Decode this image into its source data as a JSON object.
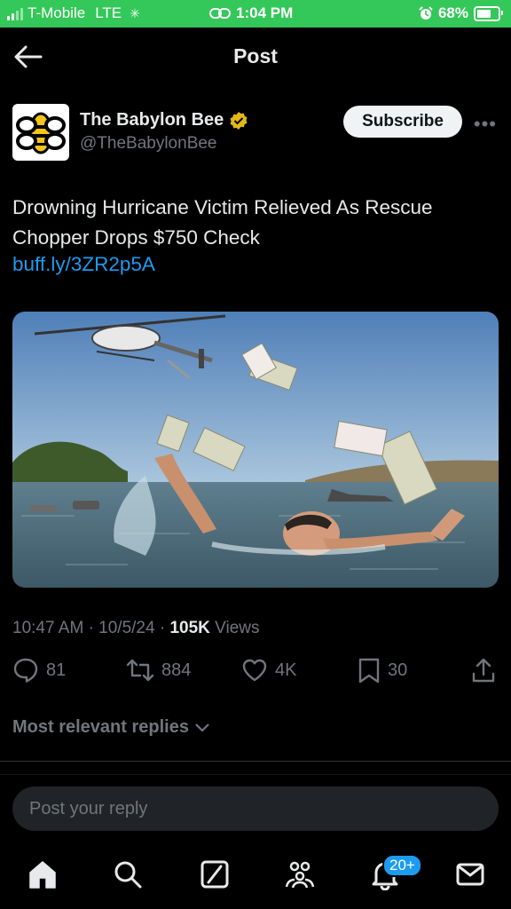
{
  "status_bar": {
    "carrier": "T-Mobile",
    "network": "LTE",
    "time": "1:04 PM",
    "battery_percent": "68%",
    "battery_level": 0.68
  },
  "nav": {
    "title": "Post"
  },
  "post": {
    "author_name": "The Babylon Bee",
    "author_handle": "@TheBabylonBee",
    "subscribe_label": "Subscribe",
    "more_label": "•••",
    "text": "Drowning Hurricane Victim Relieved As Rescue Chopper Drops $750 Check",
    "link": "buff.ly/3ZR2p5A",
    "image_alt": "Helicopter dropping checks over a man swimming in floodwater",
    "time": "10:47 AM",
    "date": "10/5/24",
    "views_count": "105K",
    "views_label": "Views"
  },
  "actions": {
    "replies": "81",
    "reposts": "884",
    "likes": "4K",
    "bookmarks": "30"
  },
  "replies_filter": "Most relevant replies",
  "reply_placeholder": "Post your reply",
  "tabbar": {
    "notifications_badge": "20+"
  },
  "colors": {
    "accent": "#1d9bf0",
    "status_bar": "#34c759",
    "background": "#000000"
  }
}
